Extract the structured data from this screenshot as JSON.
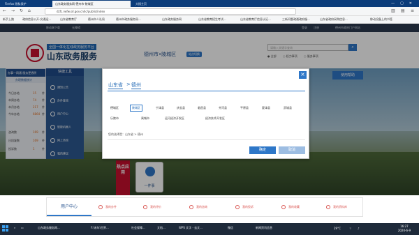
{
  "browser": {
    "tabs": [
      {
        "label": "Firefox 隐私保护"
      },
      {
        "label": "山东政务服务网 德州市-陵城区"
      },
      {
        "label": "大搜主页"
      }
    ],
    "url": "dzfc.rwfw.sd.gov.cn/lc/public/index",
    "bookmarks": [
      "新手上路",
      "政府信息公开-交通运...",
      "山东省教育厅",
      "德州市人社局",
      "德州市政务服务局...",
      "山东政务服务网",
      "山东省教育招生考试...",
      "山东省教育厅信息认证...",
      "三新问题政通政府服...",
      "山东省政府采购信息...",
      "移动设备上的书签"
    ]
  },
  "site": {
    "topstrip": {
      "left1": "移动端下载",
      "left2": "无障碍",
      "login": "登录",
      "register": "注册",
      "right": "德州市政府门户网站"
    },
    "slogan": "全国一体化在线政务服务平台",
    "sitename": "山东政务服务",
    "city": "德州市•陵城区",
    "switch": "站点切换",
    "search_placeholder": "请输入关键字查询",
    "radios": [
      "全部",
      "权力事项",
      "服务事项"
    ]
  },
  "left_panel": {
    "header": "办事一网通 服务更透明",
    "subheader": "办理数据统计",
    "stats": [
      {
        "label": "今日办结",
        "value": "15",
        "unit": "件"
      },
      {
        "label": "本周办结",
        "value": "74",
        "unit": "件"
      },
      {
        "label": "本月办结",
        "value": "217",
        "unit": "件"
      },
      {
        "label": "今年办结",
        "value": "6864",
        "unit": "件"
      },
      {
        "label": "咨询数",
        "value": "169",
        "unit": "件"
      },
      {
        "label": "日回复数",
        "value": "169",
        "unit": "件"
      },
      {
        "label": "投诉数",
        "value": "1",
        "unit": "件"
      }
    ]
  },
  "tools": {
    "header": "快捷工具",
    "items": [
      "通知公告",
      "办件查询",
      "用户中心",
      "智能机器人",
      "网上咨询",
      "我的建议"
    ]
  },
  "help_button": "使用帮助",
  "hot_badge": "热点应用",
  "one_thing": "一件事",
  "dialog": {
    "crumb_province": "山东省",
    "crumb_arrow": ">",
    "crumb_city": "德州",
    "districts_row1": [
      "德城区",
      "陵城区",
      "宁津县",
      "庆云县",
      "临邑县",
      "齐河县",
      "平原县",
      "夏津县",
      "武城县"
    ],
    "districts_row2": [
      "乐陵市",
      "禹城市",
      "运河经济开发区",
      "经济技术开发区"
    ],
    "selected": "陵城区",
    "choice": "您的选择是：山东省 > 德州",
    "ok": "确定",
    "cancel": "取消"
  },
  "bottom_tabs": {
    "active": "用户中心",
    "items": [
      "我的办件",
      "我的评价",
      "我的咨询",
      "我的投诉",
      "我的收藏",
      "我的资料库"
    ]
  },
  "taskbar": {
    "items": [
      "山东政务服务网...",
      "F:\\宋年\\世界...",
      "社会保障...",
      "文档…",
      "WPS 文字 - 云文...",
      "微信",
      "新闻资讯信息"
    ],
    "weather": "29°C",
    "time": "16:27",
    "date": "2020-6-9"
  }
}
